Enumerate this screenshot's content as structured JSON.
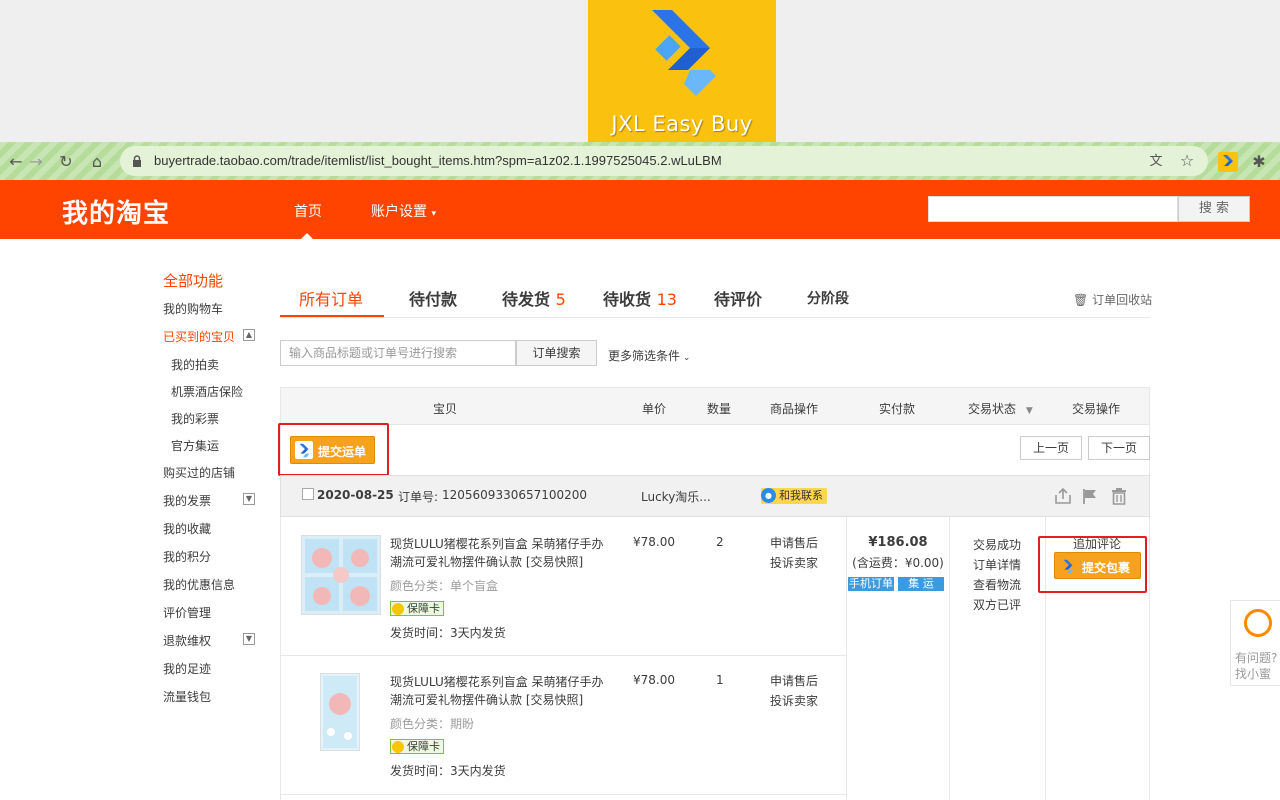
{
  "banner": {
    "logo_text": "JXL Easy Buy"
  },
  "browser": {
    "url": "buyertrade.taobao.com/trade/itemlist/list_bought_items.htm?spm=a1z02.1.1997525045.2.wLuLBM"
  },
  "header": {
    "brand": "我的淘宝",
    "nav_home": "首页",
    "nav_account": "账户设置",
    "search_button": "搜 索"
  },
  "sidebar": {
    "all_functions": "全部功能",
    "items": [
      "我的购物车",
      "已买到的宝贝",
      "我的拍卖",
      "机票酒店保险",
      "我的彩票",
      "官方集运",
      "购买过的店铺",
      "我的发票",
      "我的收藏",
      "我的积分",
      "我的优惠信息",
      "评价管理",
      "退款维权",
      "我的足迹",
      "流量钱包"
    ]
  },
  "tabs": {
    "all": "所有订单",
    "to_pay": "待付款",
    "to_ship": "待发货",
    "to_ship_count": "5",
    "to_receive": "待收货",
    "to_receive_count": "13",
    "to_review": "待评价",
    "staged": "分阶段",
    "recycle": "订单回收站"
  },
  "order_search": {
    "placeholder": "输入商品标题或订单号进行搜索",
    "button": "订单搜索",
    "more": "更多筛选条件"
  },
  "table_header": {
    "item": "宝贝",
    "unit_price": "单价",
    "quantity": "数量",
    "item_ops": "商品操作",
    "paid": "实付款",
    "status": "交易状态",
    "trade_ops": "交易操作"
  },
  "actions": {
    "submit_waybill": "提交运单",
    "prev_page": "上一页",
    "next_page": "下一页",
    "submit_package": "提交包裹"
  },
  "order": {
    "date": "2020-08-25",
    "order_no_label": "订单号:",
    "order_no": "1205609330657100200",
    "shop": "Lucky淘乐...",
    "contact": "和我联系",
    "total": "¥186.08",
    "shipping_note": "(含运费：¥0.00)",
    "badge_mobile": "手机订单",
    "badge_consolidate": "集 运",
    "status_lines": [
      "交易成功",
      "订单详情",
      "查看物流",
      "双方已评"
    ],
    "add_review": "追加评论",
    "items": [
      {
        "title": "现货LULU猪樱花系列盲盒 呆萌猪仔手办潮流可爱礼物摆件确认款 [交易快照]",
        "variant": "颜色分类：单个盲盒",
        "guarantee": "保障卡",
        "ship_time": "发货时间：3天内发货",
        "price": "¥78.00",
        "qty": "2",
        "op1": "申请售后",
        "op2": "投诉卖家"
      },
      {
        "title": "现货LULU猪樱花系列盲盒 呆萌猪仔手办潮流可爱礼物摆件确认款 [交易快照]",
        "variant": "颜色分类：期盼",
        "guarantee": "保障卡",
        "ship_time": "发货时间：3天内发货",
        "price": "¥78.00",
        "qty": "1",
        "op1": "申请售后",
        "op2": "投诉卖家"
      }
    ]
  },
  "help": {
    "line1": "有问题?",
    "line2": "找小蜜"
  },
  "colors": {
    "brand_orange": "#ff4400",
    "button_orange": "#f6a21e",
    "highlight_red": "#e02020"
  }
}
